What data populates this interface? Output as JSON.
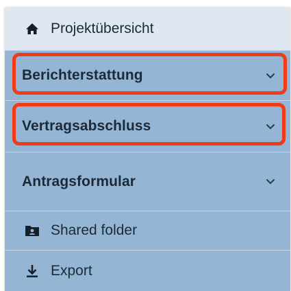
{
  "menu": {
    "items": [
      {
        "label": "Projektübersicht",
        "icon": "home-icon"
      },
      {
        "label": "Berichterstattung",
        "icon": "chevron-down-icon"
      },
      {
        "label": "Vertragsabschluss",
        "icon": "chevron-down-icon"
      },
      {
        "label": "Antragsformular",
        "icon": "chevron-down-icon"
      },
      {
        "label": "Shared folder",
        "icon": "shared-folder-icon"
      },
      {
        "label": "Export",
        "icon": "download-icon"
      }
    ]
  },
  "colors": {
    "sidebar_bg": "#95b5d4",
    "active_item_bg": "#dfe8f2",
    "highlight_border": "#f03a1a",
    "text": "#1b2a38"
  }
}
